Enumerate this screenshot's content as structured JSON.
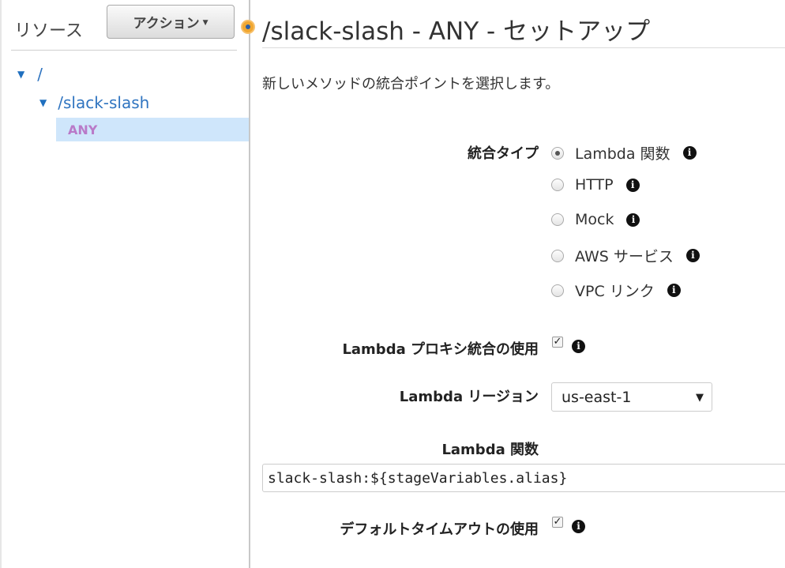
{
  "sidebar": {
    "title": "リソース",
    "action_button": "アクション",
    "tree": {
      "root": "/",
      "child": "/slack-slash",
      "method": "ANY"
    }
  },
  "main": {
    "title": "/slack-slash - ANY - セットアップ",
    "description": "新しいメソッドの統合ポイントを選択します。",
    "integration_type": {
      "label": "統合タイプ",
      "options": [
        "Lambda 関数",
        "HTTP",
        "Mock",
        "AWS サービス",
        "VPC リンク"
      ],
      "selected": "Lambda 関数"
    },
    "lambda_proxy": {
      "label": "Lambda プロキシ統合の使用",
      "checked": true
    },
    "lambda_region": {
      "label": "Lambda リージョン",
      "value": "us-east-1"
    },
    "lambda_function": {
      "label": "Lambda 関数",
      "value": "slack-slash:${stageVariables.alias}"
    },
    "default_timeout": {
      "label": "デフォルトタイムアウトの使用",
      "checked": true
    },
    "info_glyph": "i",
    "check_glyph": "✓"
  },
  "colors": {
    "link": "#2f74c0",
    "method_highlight": "#cfe6fb",
    "method_text": "#b97ac8",
    "splitter_handle": "#f0a732"
  },
  "icons": [
    "caret-down-icon",
    "tree-expand-icon",
    "info-icon",
    "checkbox-checked-icon",
    "splitter-handle-icon"
  ]
}
